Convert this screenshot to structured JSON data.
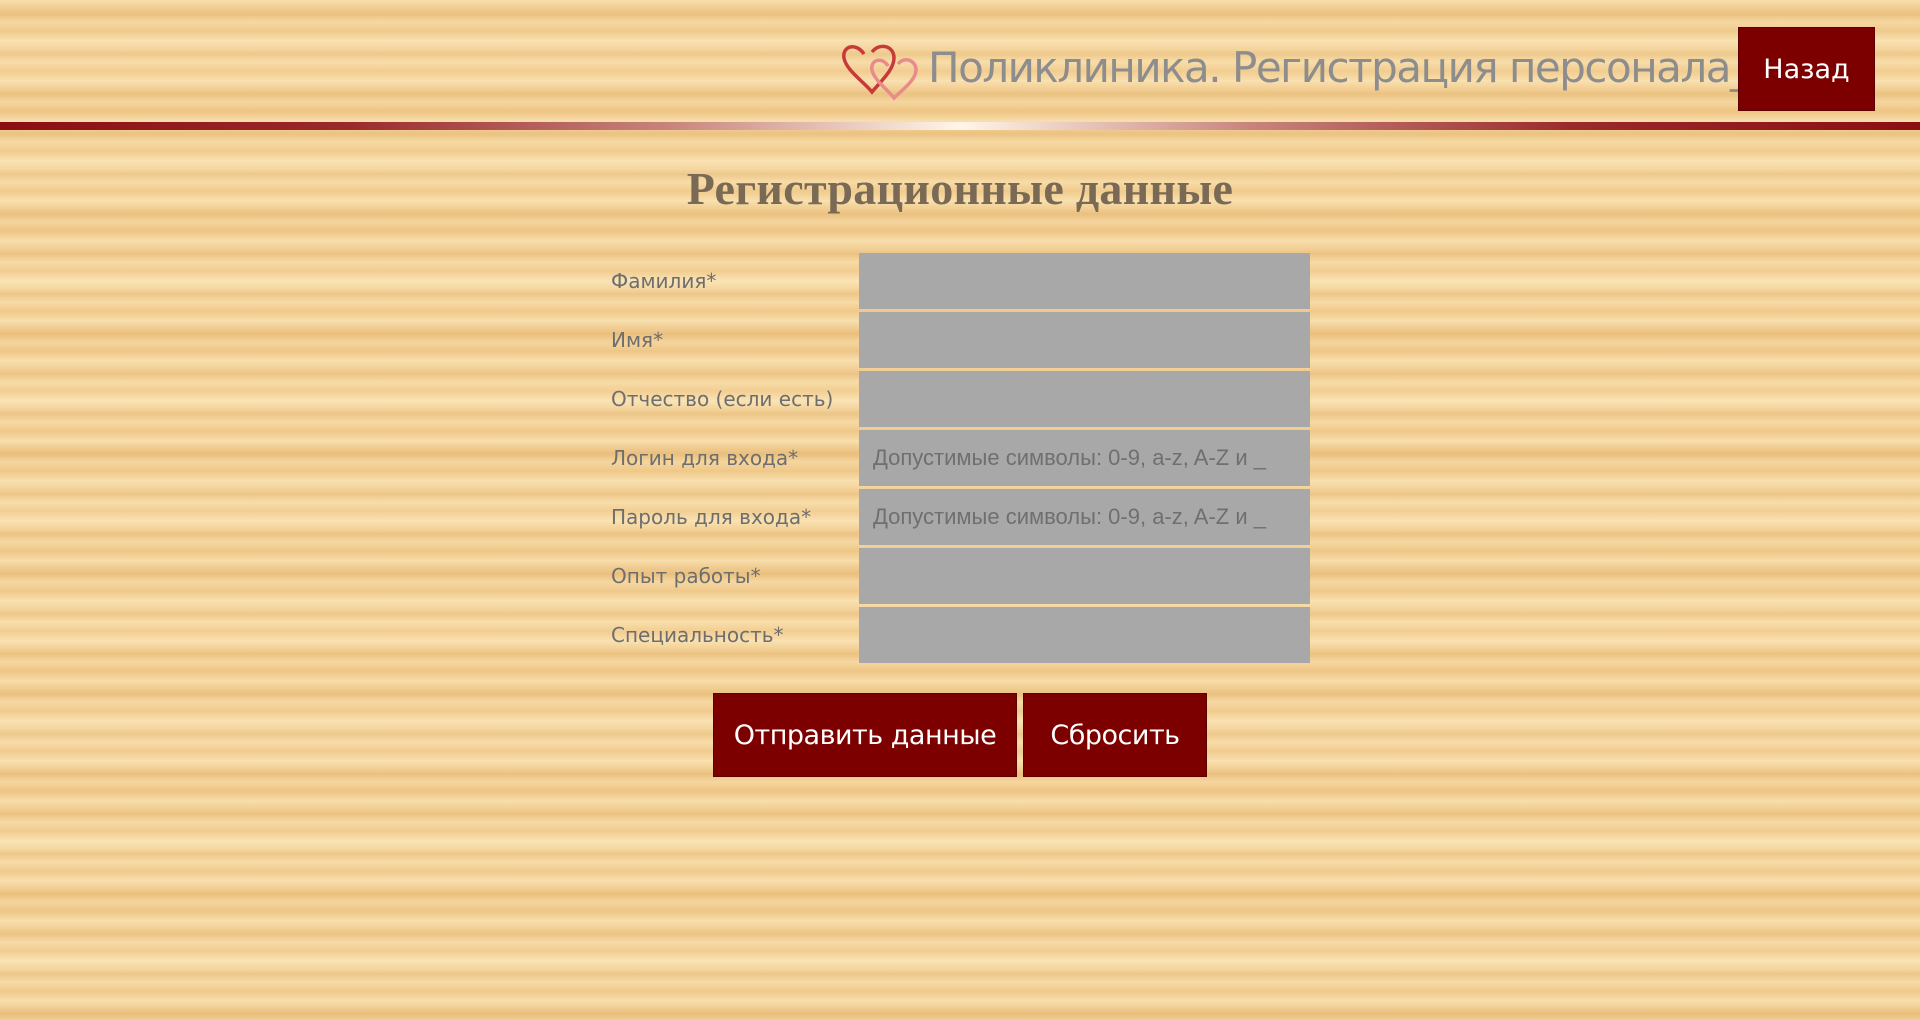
{
  "header": {
    "title": "Поликлиника. Регистрация персонала__",
    "back_label": "Назад",
    "logo_icon": "hearts-logo-icon"
  },
  "form": {
    "heading": "Регистрационные данные",
    "fields": [
      {
        "label": "Фамилия*",
        "value": "",
        "placeholder": ""
      },
      {
        "label": "Имя*",
        "value": "",
        "placeholder": ""
      },
      {
        "label": "Отчество (если есть)",
        "value": "",
        "placeholder": ""
      },
      {
        "label": "Логин для входа*",
        "value": "",
        "placeholder": "Допустимые символы: 0-9, a-z, A-Z и _"
      },
      {
        "label": "Пароль для входа*",
        "value": "",
        "placeholder": "Допустимые символы: 0-9, a-z, A-Z и _"
      },
      {
        "label": "Опыт работы*",
        "value": "",
        "placeholder": ""
      },
      {
        "label": "Специальность*",
        "value": "",
        "placeholder": ""
      }
    ],
    "submit_label": "Отправить данные",
    "reset_label": "Сбросить"
  },
  "colors": {
    "accent": "#7d0000",
    "input_bg": "#a8a8a8",
    "text": "#6e6e6e",
    "background": "#f3cf93"
  }
}
